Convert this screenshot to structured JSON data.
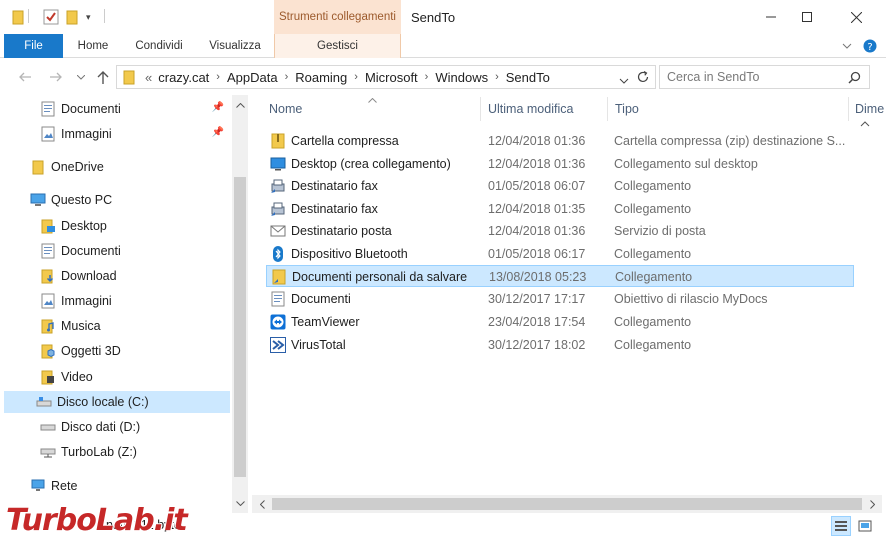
{
  "window": {
    "title": "SendTo",
    "context_tab_header": "Strumenti collegamenti"
  },
  "ribbon": {
    "tabs": [
      "File",
      "Home",
      "Condividi",
      "Visualizza",
      "Gestisci"
    ]
  },
  "address": {
    "overflow": "«",
    "breadcrumbs": [
      "crazy.cat",
      "AppData",
      "Roaming",
      "Microsoft",
      "Windows",
      "SendTo"
    ],
    "search_placeholder": "Cerca in SendTo"
  },
  "nav": {
    "items": [
      {
        "label": "Documenti",
        "icon": "documents-icon",
        "pinned": true
      },
      {
        "label": "Immagini",
        "icon": "pictures-icon",
        "pinned": true
      },
      {
        "label": "OneDrive",
        "icon": "onedrive-folder-icon"
      },
      {
        "label": "Questo PC",
        "icon": "this-pc-icon"
      },
      {
        "label": "Desktop",
        "icon": "desktop-folder-icon"
      },
      {
        "label": "Documenti",
        "icon": "documents-icon"
      },
      {
        "label": "Download",
        "icon": "downloads-icon"
      },
      {
        "label": "Immagini",
        "icon": "pictures-icon"
      },
      {
        "label": "Musica",
        "icon": "music-icon"
      },
      {
        "label": "Oggetti 3D",
        "icon": "objects-3d-icon"
      },
      {
        "label": "Video",
        "icon": "videos-icon"
      },
      {
        "label": "Disco locale (C:)",
        "icon": "local-disk-icon",
        "selected": true
      },
      {
        "label": "Disco dati (D:)",
        "icon": "drive-icon"
      },
      {
        "label": "TurboLab (Z:)",
        "icon": "network-drive-icon"
      },
      {
        "label": "Rete",
        "icon": "network-icon"
      }
    ]
  },
  "columns": [
    "Nome",
    "Ultima modifica",
    "Tipo",
    "Dime"
  ],
  "files": [
    {
      "name": "Cartella compressa",
      "date": "12/04/2018 01:36",
      "type": "Cartella compressa (zip) destinazione S...",
      "icon": "zip-folder-icon"
    },
    {
      "name": "Desktop (crea collegamento)",
      "date": "12/04/2018 01:36",
      "type": "Collegamento sul desktop",
      "icon": "desktop-shortcut-icon"
    },
    {
      "name": "Destinatario fax",
      "date": "01/05/2018 06:07",
      "type": "Collegamento",
      "icon": "fax-icon"
    },
    {
      "name": "Destinatario fax",
      "date": "12/04/2018 01:35",
      "type": "Collegamento",
      "icon": "fax-icon"
    },
    {
      "name": "Destinatario posta",
      "date": "12/04/2018 01:36",
      "type": "Servizio di posta",
      "icon": "mail-icon"
    },
    {
      "name": "Dispositivo Bluetooth",
      "date": "01/05/2018 06:17",
      "type": "Collegamento",
      "icon": "bluetooth-icon"
    },
    {
      "name": "Documenti personali da salvare",
      "date": "13/08/2018 05:23",
      "type": "Collegamento",
      "icon": "folder-shortcut-icon",
      "selected": true
    },
    {
      "name": "Documenti",
      "date": "30/12/2017 17:17",
      "type": "Obiettivo di rilascio MyDocs",
      "icon": "mydocs-icon"
    },
    {
      "name": "TeamViewer",
      "date": "23/04/2018 17:54",
      "type": "Collegamento",
      "icon": "teamviewer-icon"
    },
    {
      "name": "VirusTotal",
      "date": "30/12/2017 18:02",
      "type": "Collegamento",
      "icon": "virustotal-icon"
    }
  ],
  "status": {
    "text": "nato  811 byte",
    "watermark": "TurboLab.it"
  },
  "colors": {
    "accent": "#1979ca",
    "selection": "#cce8ff",
    "context_tab": "#fbe3d1"
  }
}
